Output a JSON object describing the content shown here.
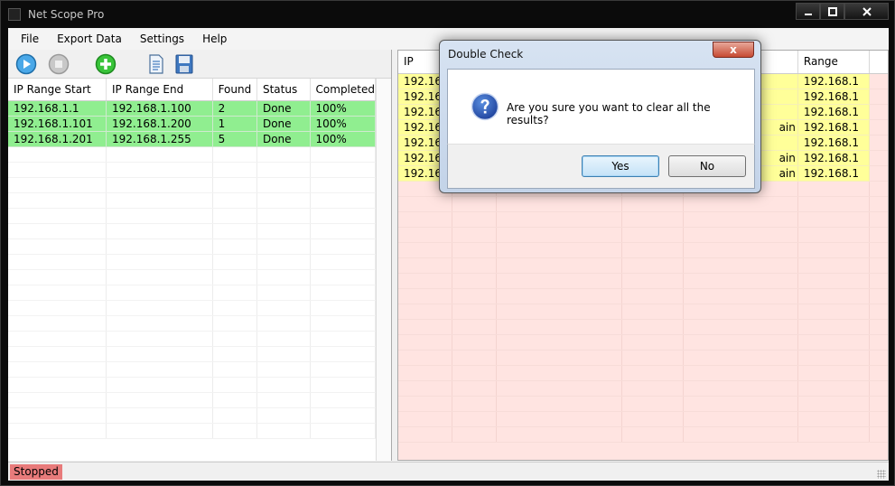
{
  "window": {
    "title": "Net Scope Pro"
  },
  "menu": [
    "File",
    "Export Data",
    "Settings",
    "Help"
  ],
  "ranges_table": {
    "columns": [
      "IP Range Start",
      "IP Range End",
      "Found",
      "Status",
      "Completed"
    ],
    "rows": [
      [
        "192.168.1.1",
        "192.168.1.100",
        "2",
        "Done",
        "100%"
      ],
      [
        "192.168.1.101",
        "192.168.1.200",
        "1",
        "Done",
        "100%"
      ],
      [
        "192.168.1.201",
        "192.168.1.255",
        "5",
        "Done",
        "100%"
      ]
    ]
  },
  "results_table": {
    "columns": [
      "IP",
      "",
      "",
      "",
      "",
      "Range"
    ],
    "rows": [
      [
        "192.168.",
        "",
        "",
        "",
        "",
        "192.168.1"
      ],
      [
        "192.168.",
        "",
        "",
        "",
        "",
        "192.168.1"
      ],
      [
        "192.168.",
        "",
        "",
        "",
        "",
        "192.168.1"
      ],
      [
        "192.168.",
        "",
        "",
        "",
        "ain",
        "192.168.1"
      ],
      [
        "192.168.",
        "",
        "",
        "",
        "",
        "192.168.1"
      ],
      [
        "192.168.",
        "",
        "",
        "",
        "ain",
        "192.168.1"
      ],
      [
        "192.168.",
        "",
        "",
        "",
        "ain",
        "192.168.1"
      ]
    ]
  },
  "status": {
    "text": "Stopped",
    "color": "#e87b7b"
  },
  "dialog": {
    "title": "Double Check",
    "message": "Are you sure you want to clear all the results?",
    "yes_label": "Yes",
    "no_label": "No",
    "close_glyph": "x"
  },
  "colors": {
    "done_row": "#90ee90",
    "result_hit": "#ffff99",
    "results_bg": "#ffe4e1"
  }
}
